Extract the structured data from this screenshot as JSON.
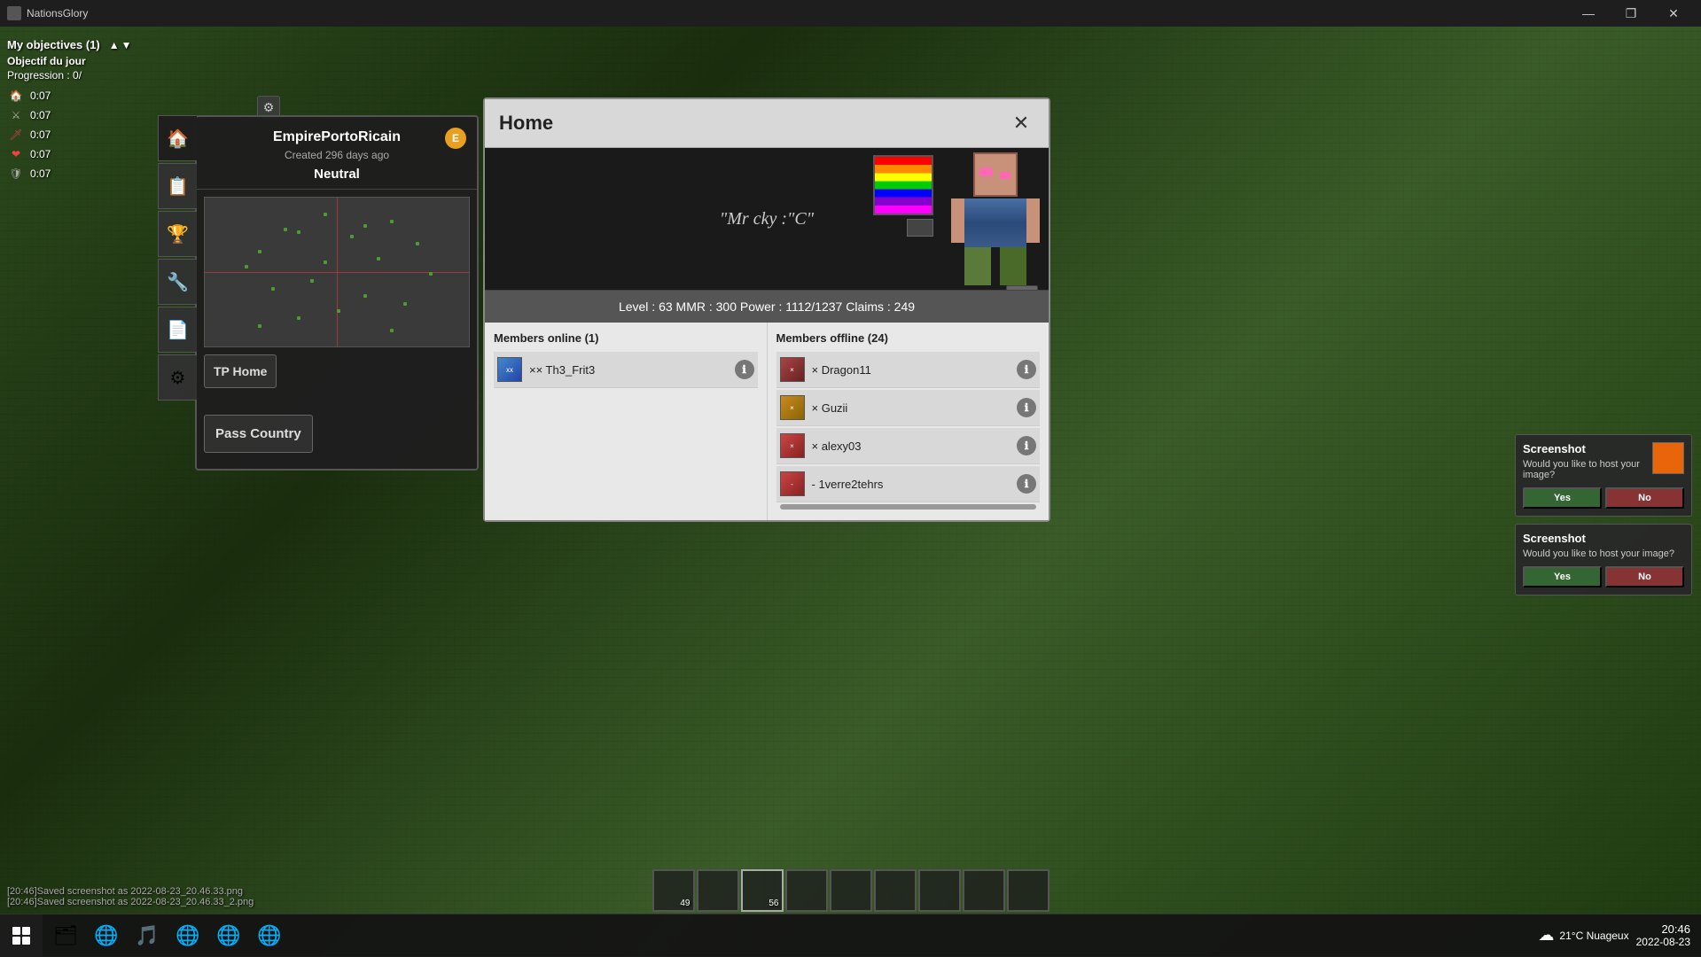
{
  "window": {
    "title": "NationsGlory",
    "controls": {
      "minimize": "—",
      "maximize": "❐",
      "close": "✕"
    }
  },
  "hud": {
    "objectives_label": "My objectives (1)",
    "objectives_day": "Objectif du jour",
    "progression_label": "Progression :",
    "progression_value": "0/",
    "stats": [
      {
        "icon": "🏠",
        "value": "0:07",
        "color": "#aa5555"
      },
      {
        "icon": "⚔",
        "value": "0:07",
        "color": "#aaaaaa"
      },
      {
        "icon": "🗡",
        "value": "0:07",
        "color": "#cc4444"
      },
      {
        "icon": "❤",
        "value": "0:07",
        "color": "#ee4444"
      },
      {
        "icon": "🛡",
        "value": "0:07",
        "color": "#aaaaaa"
      }
    ]
  },
  "nation_panel": {
    "name": "EmpirePortoRicain",
    "created": "Created 296 days ago",
    "badge": "E",
    "status": "Neutral",
    "tp_home_label": "TP Home",
    "pass_country_label": "Pass Country"
  },
  "home_dialog": {
    "title": "Home",
    "close_btn": "✕",
    "banner_text": "\"Mr cky :\"C\"",
    "stats": "Level : 63   MMR : 300   Power : 1112/1237   Claims : 249",
    "members_online_title": "Members online (1)",
    "members_offline_title": "Members offline (24)",
    "members_online": [
      {
        "name": "×× Th3_Frit3",
        "prefix": "xx"
      }
    ],
    "members_offline": [
      {
        "name": "× Dragon11"
      },
      {
        "name": "× Guzii"
      },
      {
        "name": "× alexy03"
      },
      {
        "name": "- 1verre2tehrs"
      }
    ]
  },
  "sidebar_tabs": [
    {
      "icon": "🏠",
      "label": "home-tab"
    },
    {
      "icon": "📋",
      "label": "list-tab"
    },
    {
      "icon": "🏆",
      "label": "trophy-tab"
    },
    {
      "icon": "🔧",
      "label": "tools-tab"
    },
    {
      "icon": "📄",
      "label": "doc-tab"
    },
    {
      "icon": "⚙",
      "label": "settings-tab"
    }
  ],
  "screenshot_panels": [
    {
      "title": "Screenshot",
      "subtitle": "Would you like to host your image?",
      "yes": "Yes",
      "no": "No"
    },
    {
      "title": "Screenshot",
      "subtitle": "Would you like to host your image?",
      "yes": "Yes",
      "no": "No"
    }
  ],
  "hotbar_slots": [
    {
      "count": "49"
    },
    {},
    {
      "count": "56"
    },
    {},
    {},
    {},
    {},
    {},
    {}
  ],
  "taskbar": {
    "apps": [
      "🗂",
      "🌐",
      "🎵",
      "🌐",
      "🌐",
      "🌐"
    ],
    "weather_temp": "21°C  Nuageux",
    "time": "20:46",
    "date": "2022-08-23"
  }
}
